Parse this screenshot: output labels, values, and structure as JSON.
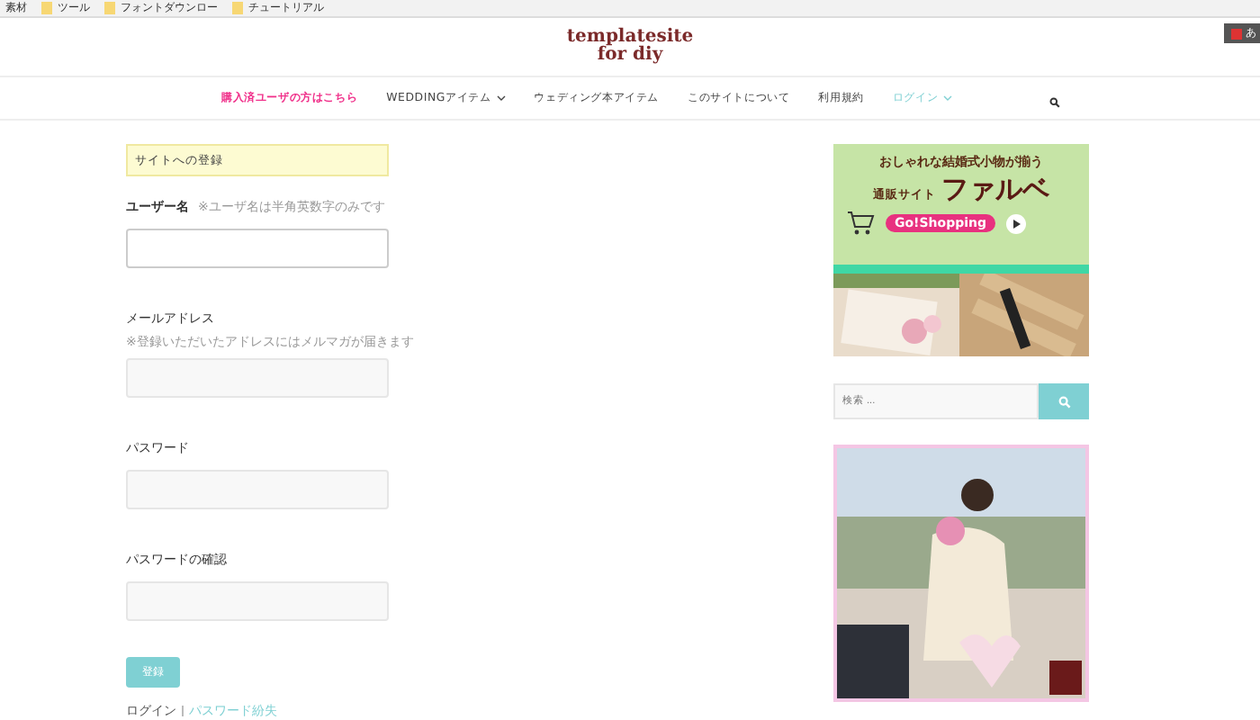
{
  "bookmarks": [
    {
      "label": "素材",
      "kind": "text"
    },
    {
      "label": "ツール",
      "kind": "folder"
    },
    {
      "label": "フォントダウンロー",
      "kind": "folder"
    },
    {
      "label": "チュートリアル",
      "kind": "folder"
    }
  ],
  "corner_widget": {
    "label": "あ"
  },
  "site": {
    "title_lines": [
      "templatesite",
      "for diy"
    ]
  },
  "nav": [
    {
      "label": "購入済ユーザの方はこちら",
      "kind": "promo",
      "has_menu": false,
      "selected": false
    },
    {
      "label": "WEDDINGアイテム",
      "kind": "plain",
      "has_menu": true,
      "selected": false
    },
    {
      "label": "ウェディング本アイテム",
      "kind": "plain",
      "has_menu": false,
      "selected": false
    },
    {
      "label": "このサイトについて",
      "kind": "plain",
      "has_menu": false,
      "selected": false
    },
    {
      "label": "利用規約",
      "kind": "plain",
      "has_menu": false,
      "selected": false
    },
    {
      "label": "ログイン",
      "kind": "plain",
      "has_menu": true,
      "selected": true
    }
  ],
  "form": {
    "notice": "サイトへの登録",
    "fields": [
      {
        "label": "ユーザー名",
        "note": "※ユーザ名は半角英数字のみです",
        "focused": true
      },
      {
        "label": "メールアドレス",
        "hint": "※登録いただいたアドレスにはメルマガが届きます",
        "focused": false
      },
      {
        "label": "パスワード",
        "focused": false
      },
      {
        "label": "パスワードの確認",
        "focused": false
      }
    ],
    "submit": "登録",
    "links": [
      "ログイン",
      "パスワード紛失"
    ]
  },
  "sidebar": {
    "ad": {
      "tagline": "おしゃれな結婚式小物が揃う",
      "prefix": "通販サイト",
      "brand": "ファルベ",
      "cta": "Go!Shopping"
    },
    "search": {
      "placeholder": "検索 ..."
    }
  }
}
